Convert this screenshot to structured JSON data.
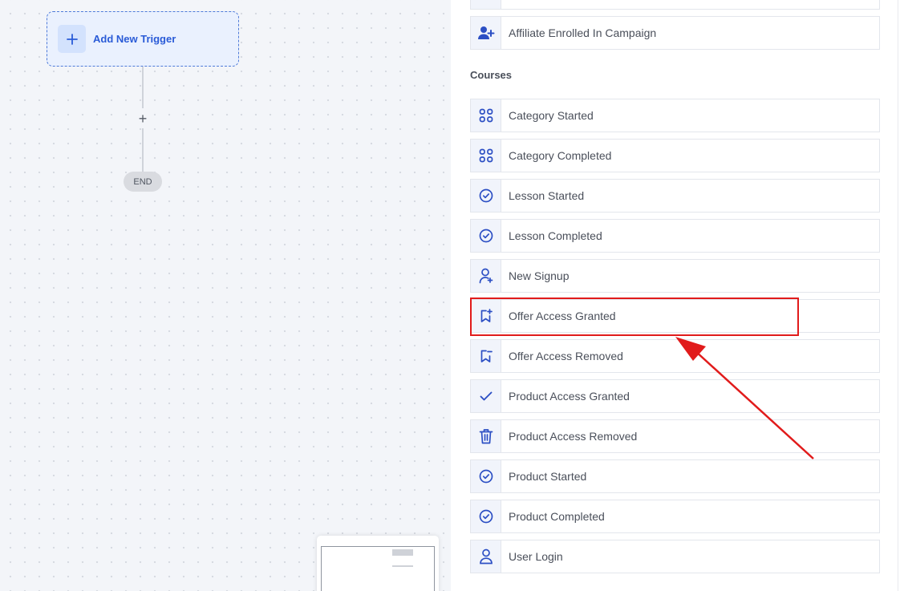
{
  "canvas": {
    "add_trigger_label": "Add New Trigger",
    "connector_plus": "+",
    "end_label": "END"
  },
  "panel": {
    "top_partial_item": {
      "label": "",
      "icon": "partial-icon"
    },
    "affiliate_item": {
      "label": "Affiliate Enrolled In Campaign",
      "icon": "user-plus-icon"
    },
    "section_title": "Courses",
    "items": [
      {
        "label": "Category Started",
        "icon": "grid-icon"
      },
      {
        "label": "Category Completed",
        "icon": "grid-icon"
      },
      {
        "label": "Lesson Started",
        "icon": "check-circle-icon"
      },
      {
        "label": "Lesson Completed",
        "icon": "check-circle-icon"
      },
      {
        "label": "New Signup",
        "icon": "user-add-icon"
      },
      {
        "label": "Offer Access Granted",
        "icon": "bookmark-plus-icon"
      },
      {
        "label": "Offer Access Removed",
        "icon": "bookmark-minus-icon"
      },
      {
        "label": "Product Access Granted",
        "icon": "check-icon"
      },
      {
        "label": "Product Access Removed",
        "icon": "trash-icon"
      },
      {
        "label": "Product Started",
        "icon": "check-circle-icon"
      },
      {
        "label": "Product Completed",
        "icon": "check-circle-icon"
      },
      {
        "label": "User Login",
        "icon": "user-icon"
      }
    ]
  },
  "colors": {
    "accent": "#2a5bd7",
    "annotation": "#e11b1b",
    "icon": "#2c4fc4"
  }
}
